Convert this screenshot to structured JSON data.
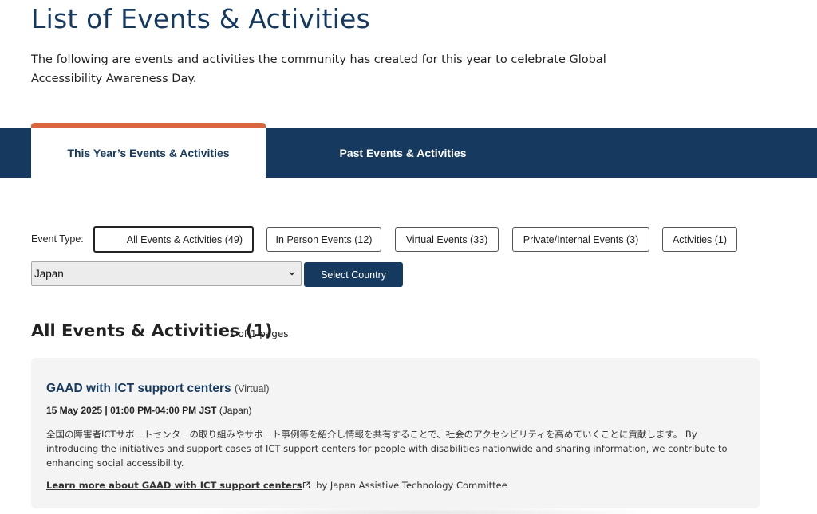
{
  "header": {
    "title": "List of Events & Activities",
    "intro": "The following are events and activities the community has created for this year to celebrate Global Accessibility Awareness Day."
  },
  "tabs": [
    {
      "label": "This Year’s Events & Activities",
      "active": true
    },
    {
      "label": "Past Events & Activities",
      "active": false
    }
  ],
  "filters": {
    "label": "Event Type:",
    "buttons": [
      {
        "label": "All Events & Activities (49)",
        "selected": true
      },
      {
        "label": "In Person Events (12)",
        "selected": false
      },
      {
        "label": "Virtual Events (33)",
        "selected": false
      },
      {
        "label": "Private/Internal Events (3)",
        "selected": false
      },
      {
        "label": "Activities (1)",
        "selected": false
      }
    ],
    "country": {
      "value": "Japan",
      "icon": "chevron-down-icon"
    },
    "select_country_label": "Select Country"
  },
  "results": {
    "heading": "All Events & Activities (1)",
    "pages": "1 of 1 pages"
  },
  "events": [
    {
      "title": "GAAD with ICT support centers",
      "kind": "(Virtual)",
      "date": "15 May 2025 | 01:00 PM-04:00 PM JST",
      "country": "(Japan)",
      "description": "全国の障害者ICTサポートセンターの取り組みやサポート事例等を紹介し情報を共有することで、社会のアクセシビリティを高めていくことに貢献します。 By introducing the initiatives and support cases of ICT support centers for people with disabilities nationwide and sharing information, we contribute to enhancing social accessibility.",
      "link_text": "Learn more about GAAD with ICT support centers",
      "link_icon": "external-link-icon",
      "organizer": "by Japan Assistive Technology Committee"
    }
  ],
  "colors": {
    "brand_navy": "#163a5f",
    "tab_accent": "#d9663e",
    "card_bg": "#f4f4f4"
  }
}
